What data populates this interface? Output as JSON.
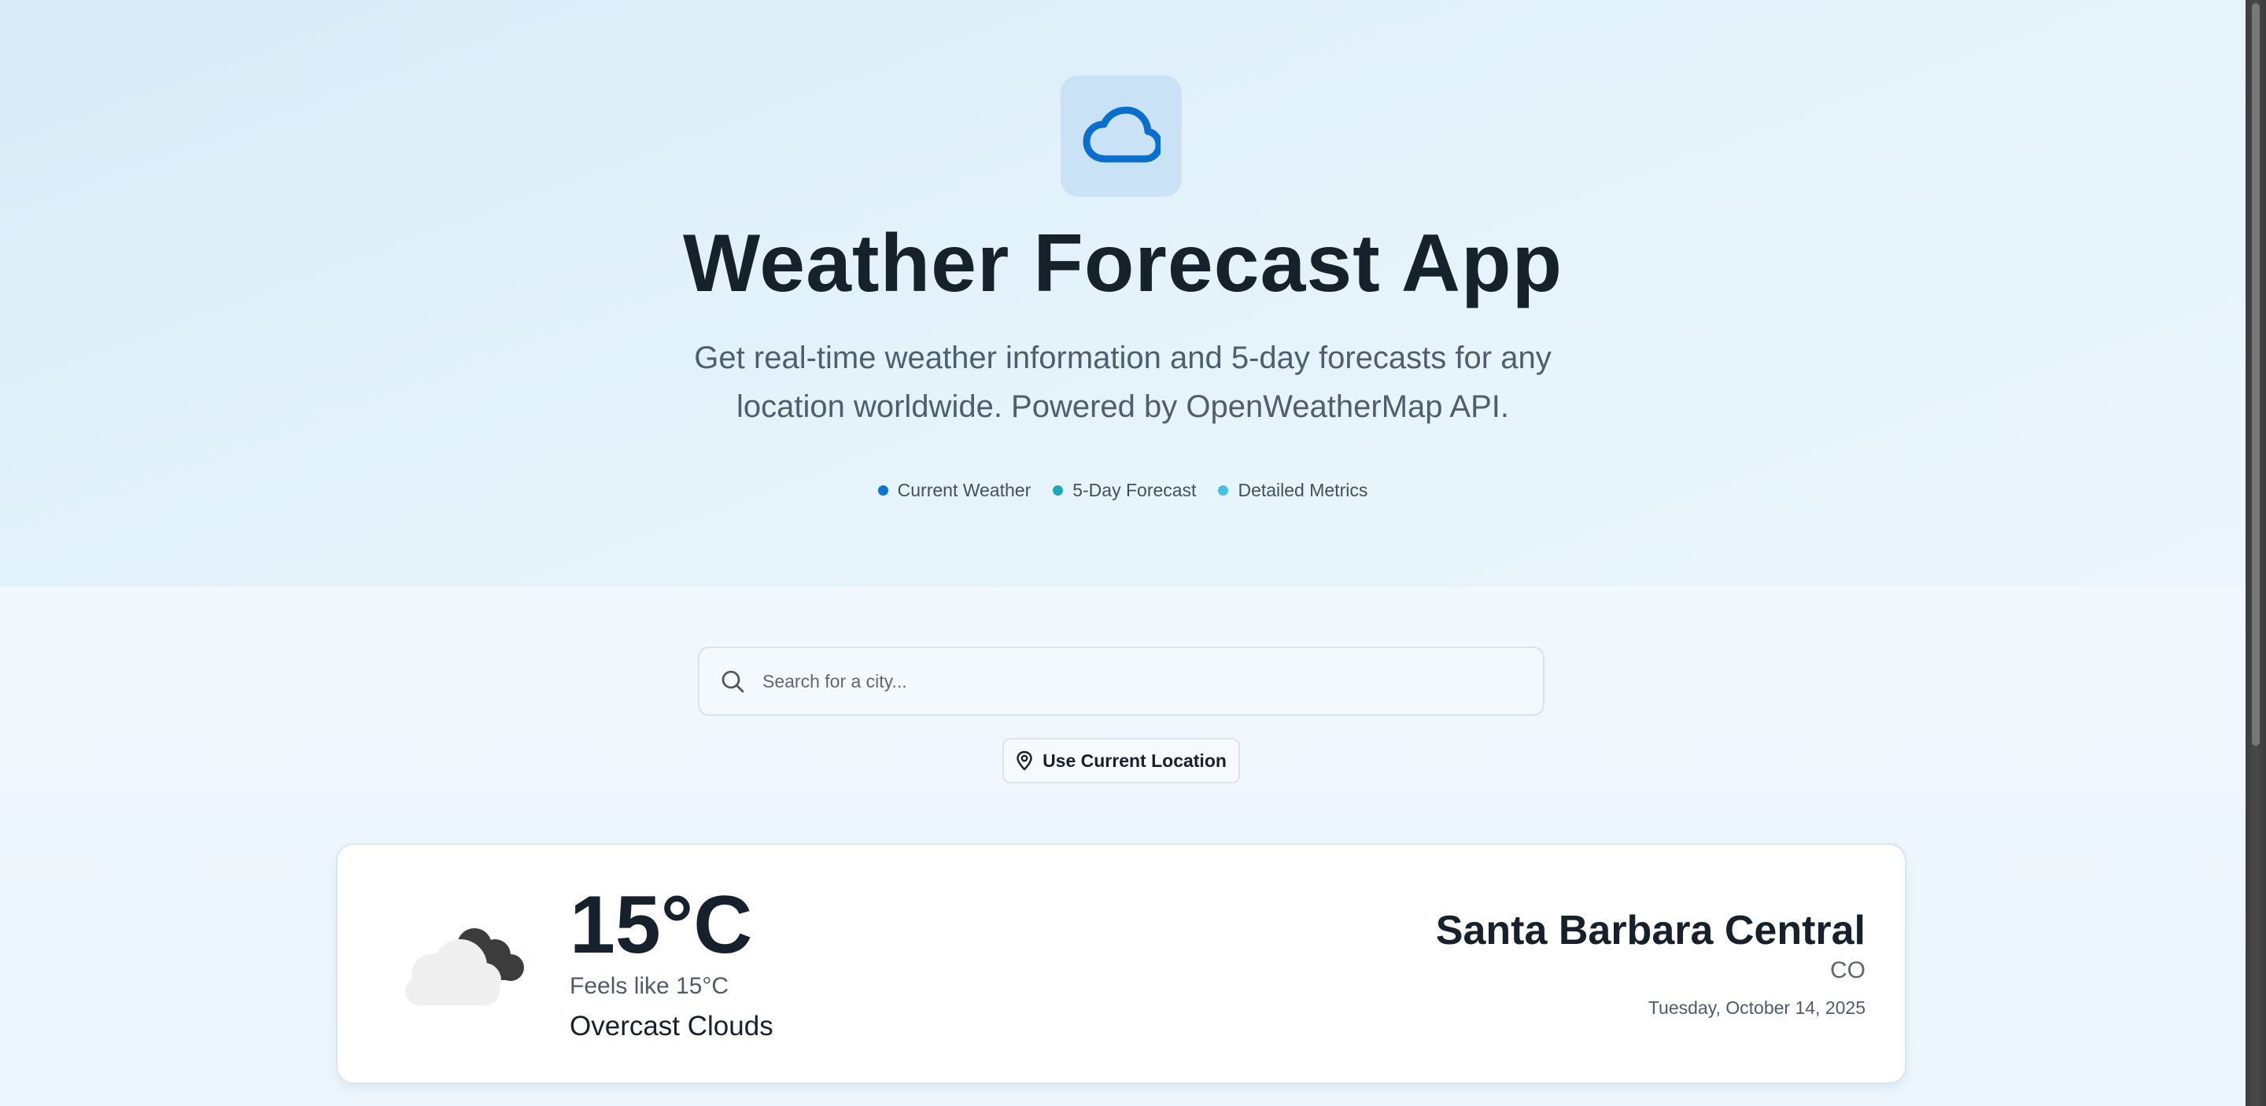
{
  "app": {
    "title": "Weather Forecast App",
    "subtitle": "Get real-time weather information and 5-day forecasts for any location worldwide. Powered by OpenWeatherMap API.",
    "logo_icon": "cloud-icon"
  },
  "features": [
    {
      "label": "Current Weather",
      "dot_color": "#0a74d6"
    },
    {
      "label": "5-Day Forecast",
      "dot_color": "#1aa7b8"
    },
    {
      "label": "Detailed Metrics",
      "dot_color": "#47bfe0"
    }
  ],
  "search": {
    "placeholder": "Search for a city...",
    "value": "",
    "icon": "search-icon"
  },
  "location_button": {
    "label": "Use Current Location",
    "icon": "map-pin-icon"
  },
  "current": {
    "temperature": "15°C",
    "feels_like": "Feels like 15°C",
    "condition": "Overcast Clouds",
    "icon": "overcast-clouds-icon",
    "city": "Santa Barbara Central",
    "country": "CO",
    "date": "Tuesday, October 14, 2025"
  },
  "colors": {
    "accent": "#0a74d6",
    "logo_bg": "#c9e2f6",
    "title_text": "#17212b"
  }
}
